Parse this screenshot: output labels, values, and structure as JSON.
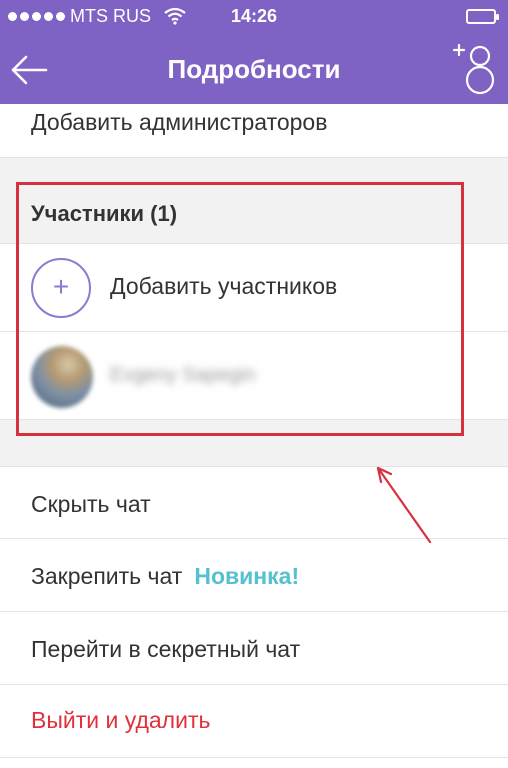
{
  "status_bar": {
    "carrier": "MTS RUS",
    "time": "14:26"
  },
  "nav": {
    "title": "Подробности"
  },
  "items": {
    "add_admins": "Добавить администраторов",
    "participants_header": "Участники (1)",
    "add_participants": "Добавить участников",
    "add_participants_icon": "+",
    "member_name": "Evgeny Sapegin",
    "hide_chat": "Скрыть чат",
    "pin_chat": "Закрепить чат",
    "pin_badge": "Новинка!",
    "secret_chat": "Перейти в секретный чат",
    "leave_delete": "Выйти и удалить"
  },
  "colors": {
    "brand": "#7e62c4",
    "accent_badge": "#55c0cf",
    "danger": "#e0303b",
    "highlight": "#d6313e"
  },
  "icons": {
    "back": "back-arrow-icon",
    "add_contact": "add-contact-icon",
    "wifi": "wifi-icon",
    "battery": "battery-icon"
  }
}
